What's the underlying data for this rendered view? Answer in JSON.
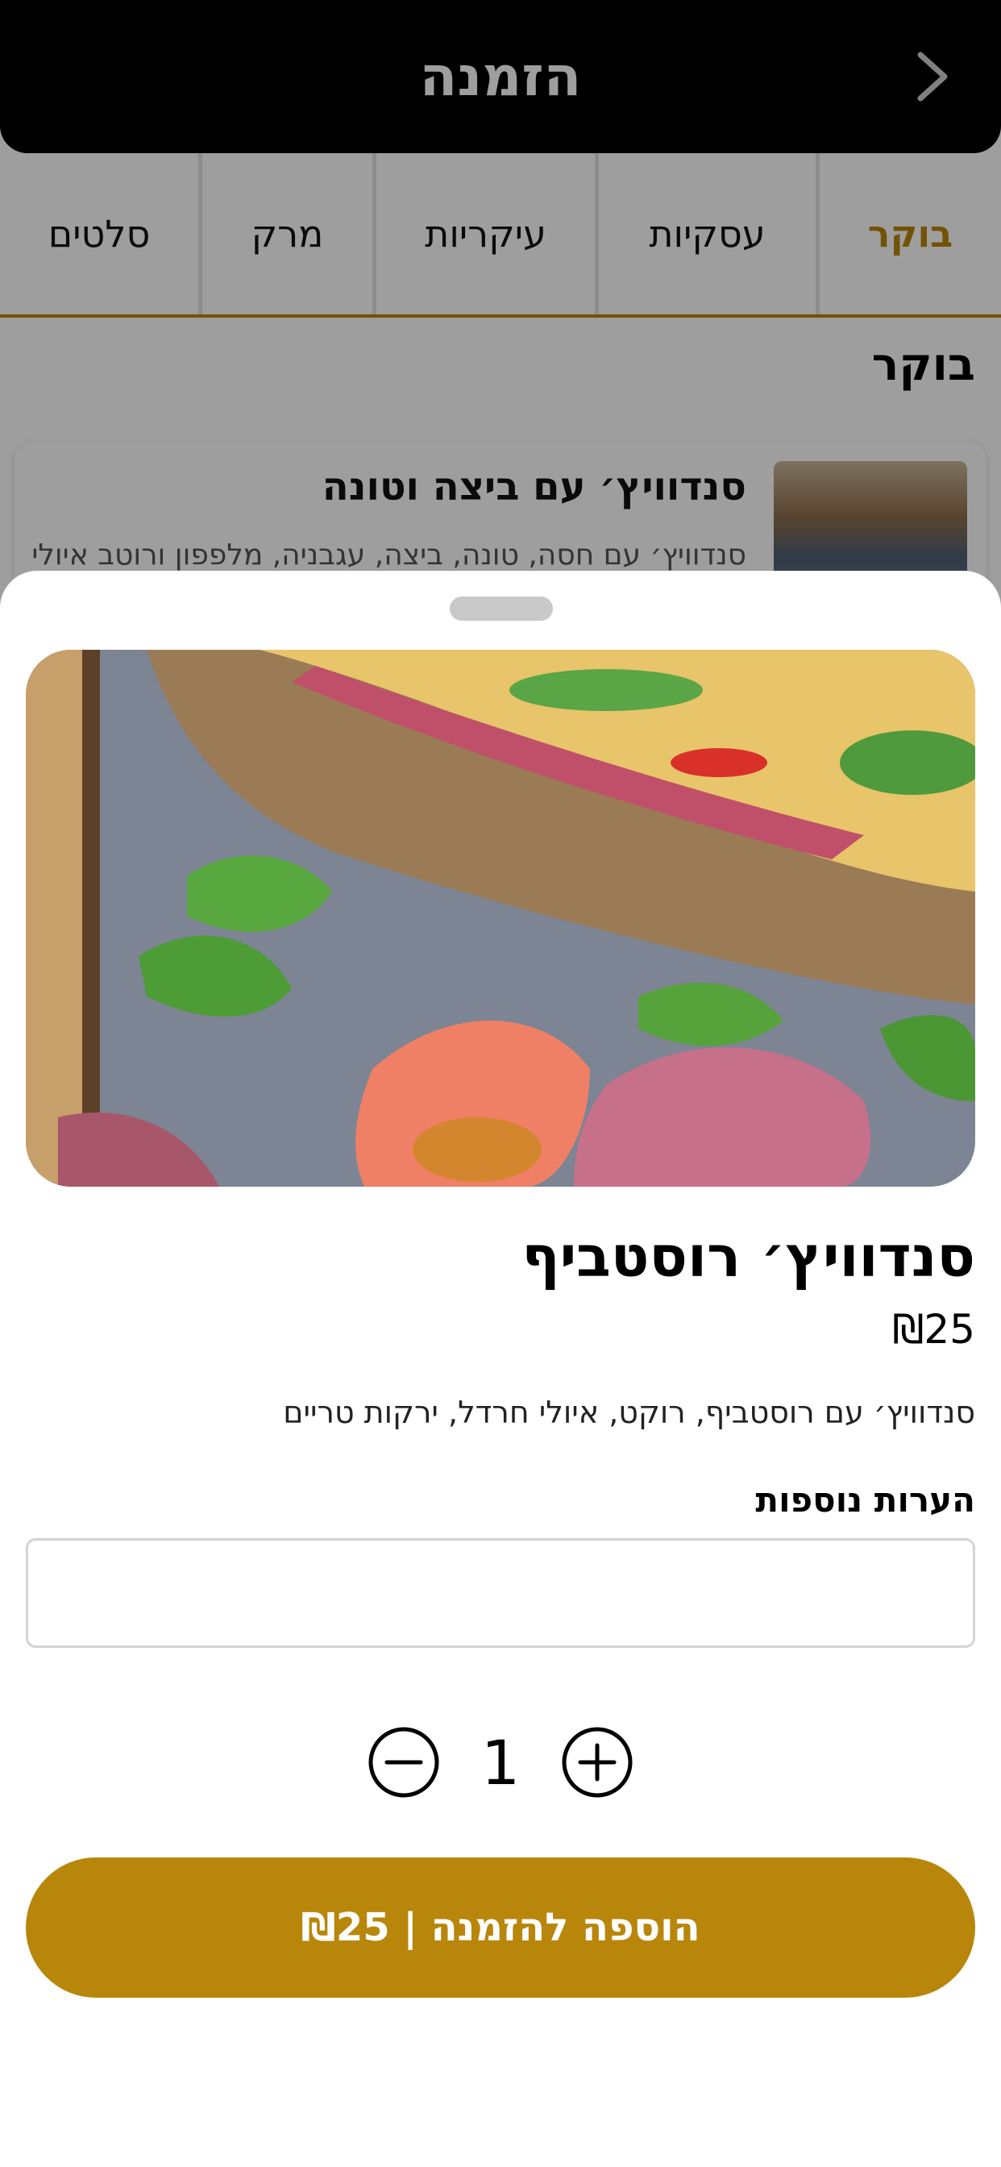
{
  "header": {
    "title": "הזמנה",
    "back_icon": "chevron-right-icon"
  },
  "tabs": [
    {
      "label": "בוקר",
      "active": true
    },
    {
      "label": "עסקיות",
      "active": false
    },
    {
      "label": "עיקריות",
      "active": false
    },
    {
      "label": "מרק",
      "active": false
    },
    {
      "label": "סלטים",
      "active": false
    }
  ],
  "section": {
    "title": "בוקר"
  },
  "background_item": {
    "title": "סנדוויץ׳ עם ביצה וטונה",
    "description": "סנדוויץ׳ עם חסה, טונה, ביצה, עגבניה, מלפפון ורוטב איולי"
  },
  "sheet": {
    "product_title": "סנדוויץ׳ רוסטביף",
    "price": "₪25",
    "description": "סנדוויץ׳ עם רוסטביף, רוקט, איולי חרדל, ירקות טריים",
    "notes_label": "הערות נוספות",
    "notes_value": "",
    "quantity": "1",
    "add_button_label": "הוספה להזמנה | ₪25"
  },
  "colors": {
    "accent": "#b8860b",
    "header_bg": "#000000"
  }
}
